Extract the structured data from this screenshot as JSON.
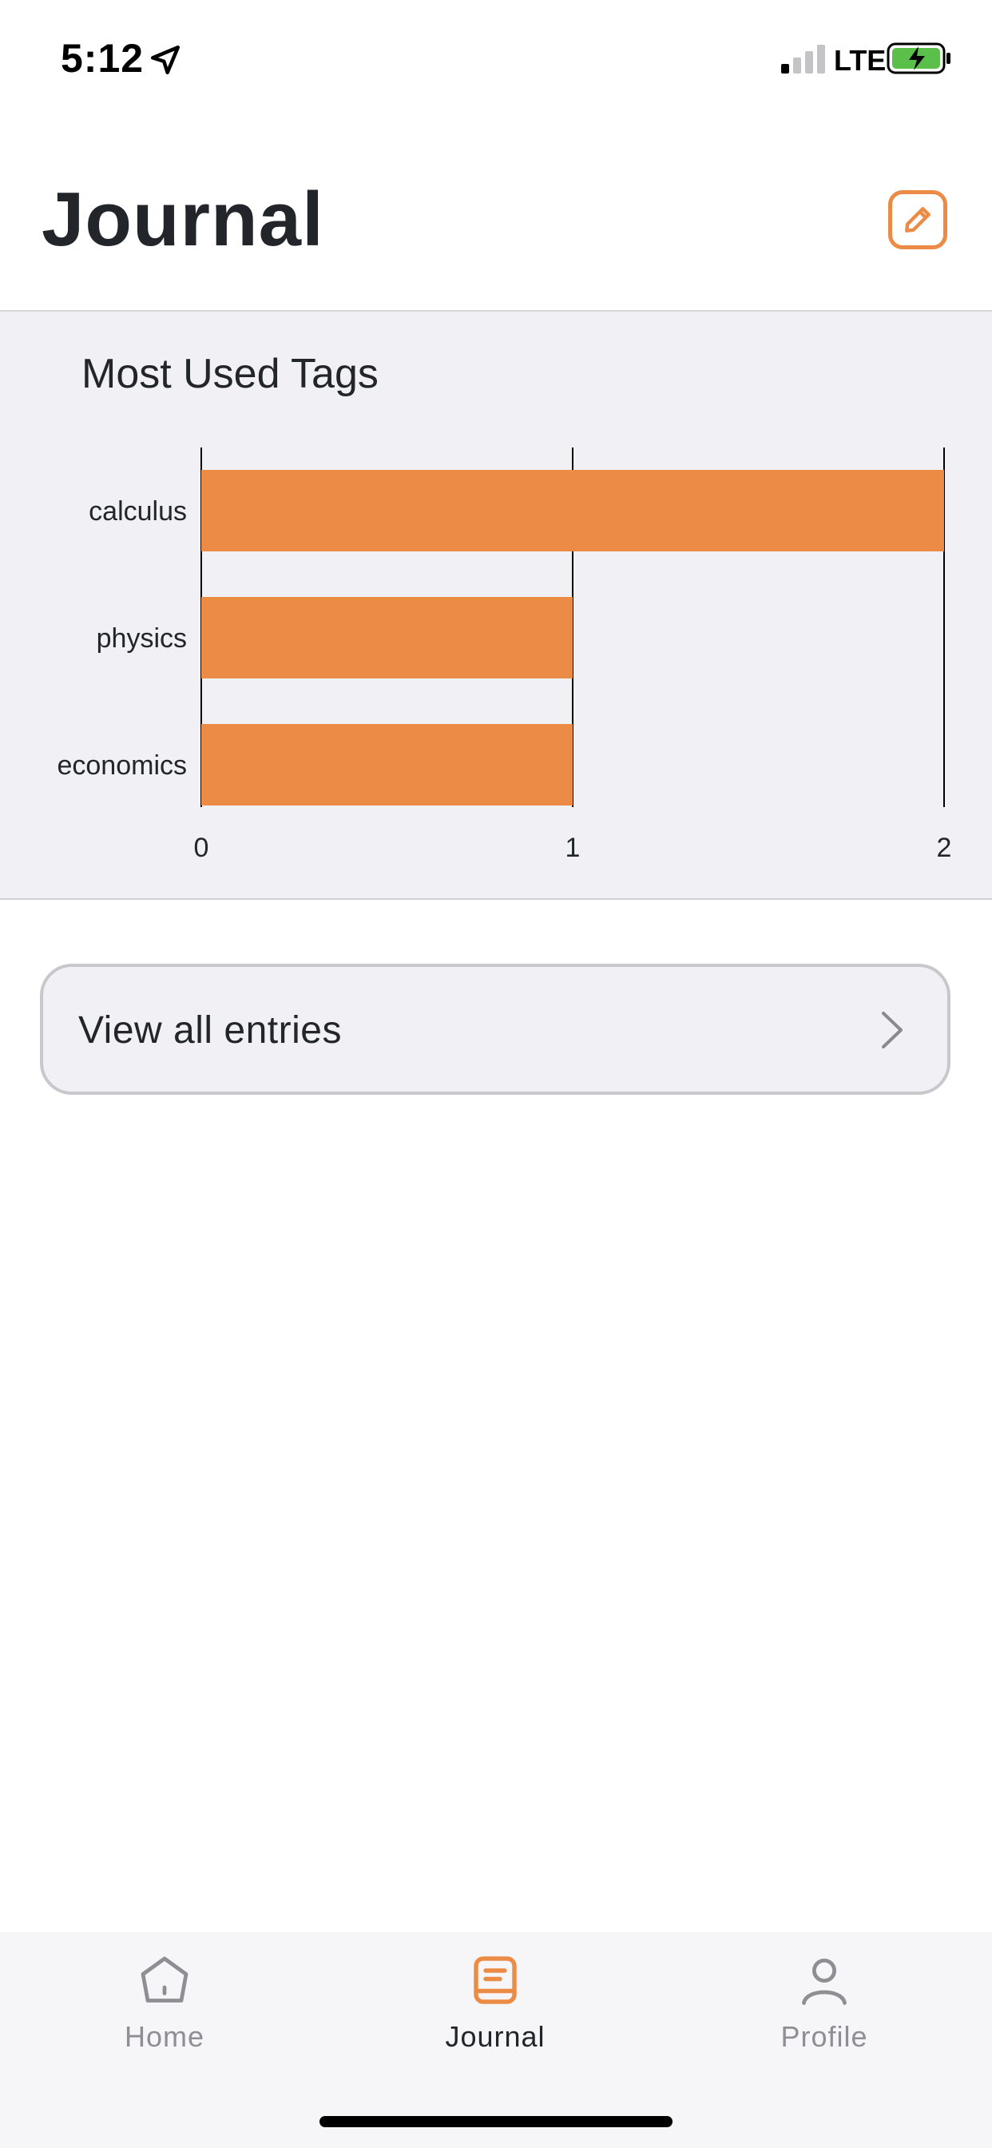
{
  "status_bar": {
    "time": "5:12",
    "network": "LTE",
    "icons": [
      "location-arrow-icon",
      "signal-icon",
      "battery-charging-icon"
    ]
  },
  "header": {
    "title": "Journal",
    "action_icon": "edit-icon"
  },
  "chart_data": {
    "type": "bar",
    "orientation": "horizontal",
    "title": "Most Used Tags",
    "categories": [
      "calculus",
      "physics",
      "economics"
    ],
    "values": [
      2,
      1,
      1
    ],
    "xlim": [
      0,
      2
    ],
    "xticks": [
      "0",
      "1",
      "2"
    ],
    "grid": true,
    "bar_color": "#ec8b46"
  },
  "entries_button": {
    "label": "View all entries",
    "icon": "chevron-right-icon"
  },
  "tab_bar": {
    "active_color": "#ec8b46",
    "inactive_color": "#8e8e93",
    "tabs": [
      {
        "label": "Home",
        "icon": "home-icon",
        "active": false
      },
      {
        "label": "Journal",
        "icon": "journal-icon",
        "active": true
      },
      {
        "label": "Profile",
        "icon": "profile-icon",
        "active": false
      }
    ]
  }
}
